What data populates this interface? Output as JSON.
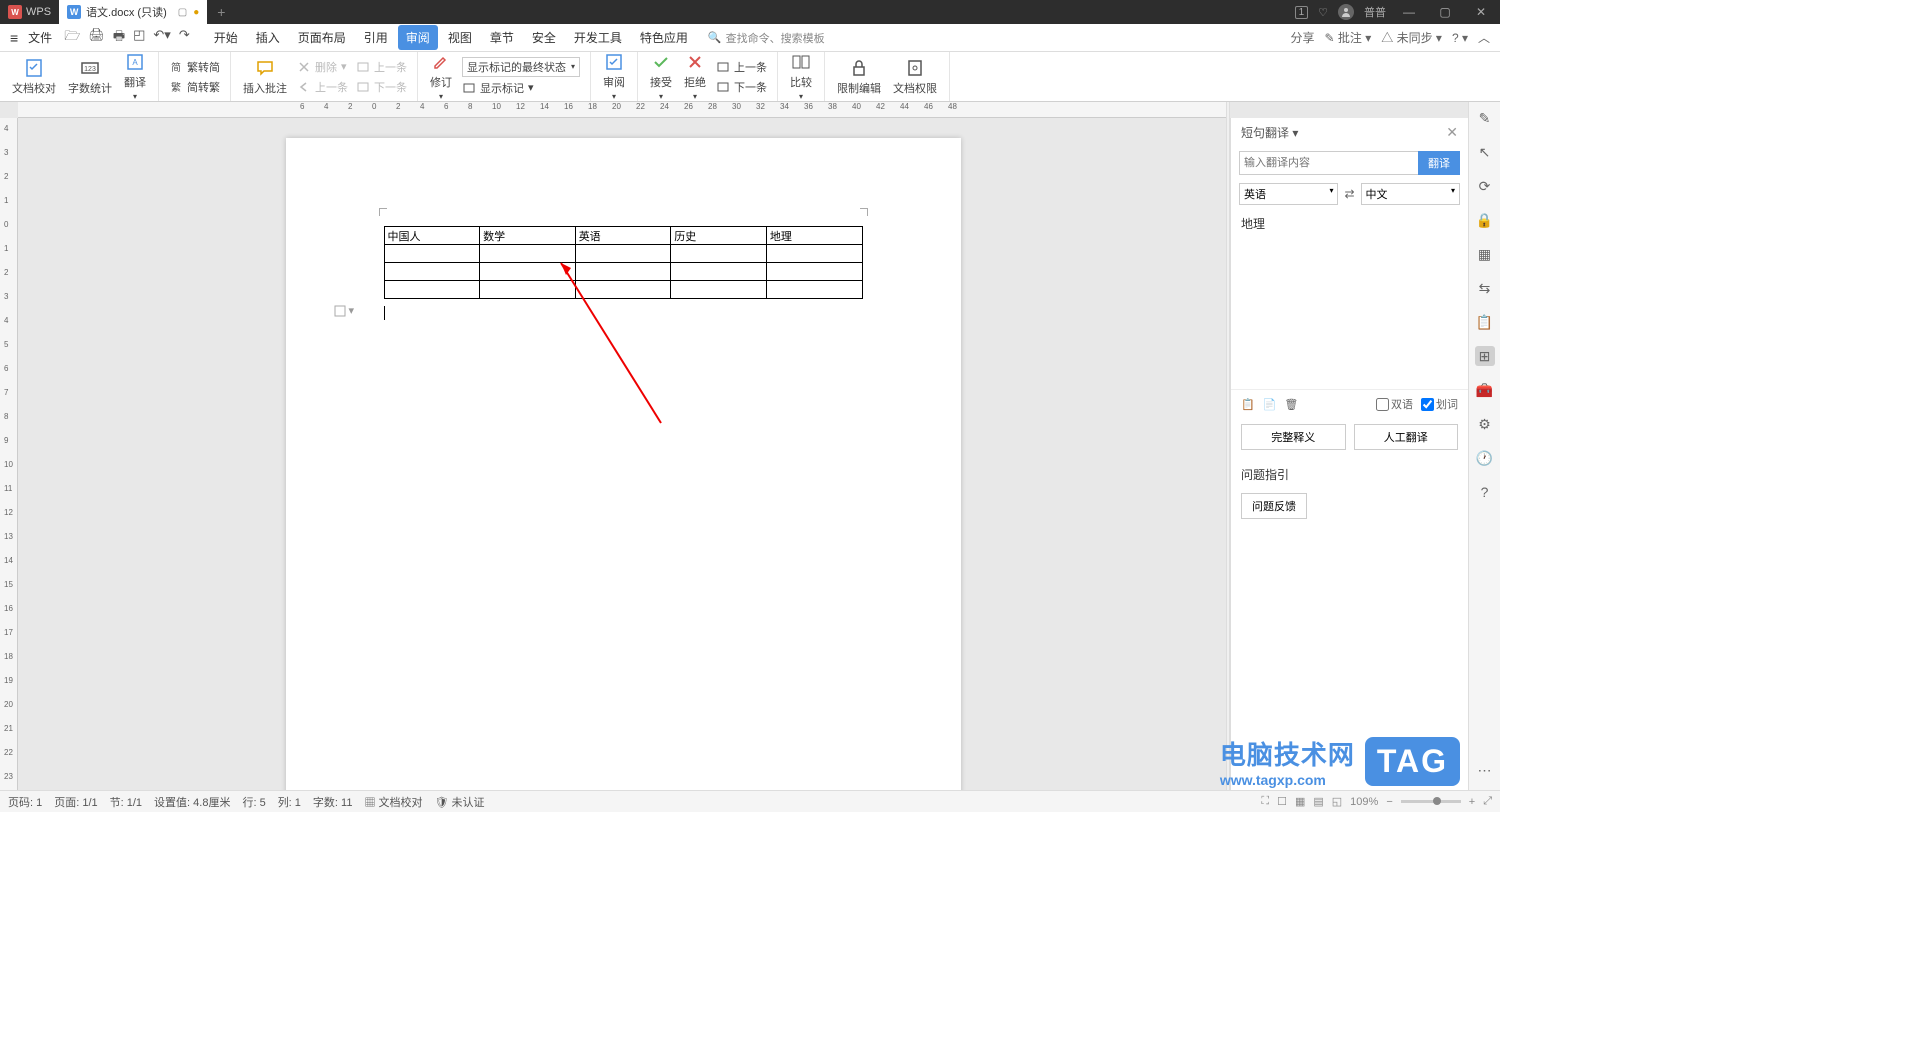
{
  "titlebar": {
    "app_name": "WPS",
    "doc_tab": "语文.docx (只读)",
    "user_name": "普普"
  },
  "menubar": {
    "file": "文件",
    "tabs": [
      "开始",
      "插入",
      "页面布局",
      "引用",
      "审阅",
      "视图",
      "章节",
      "安全",
      "开发工具",
      "特色应用"
    ],
    "active_tab": "审阅",
    "search_placeholder": "查找命令、搜索模板",
    "share": "分享",
    "comment": "批注",
    "sync": "未同步"
  },
  "ribbon": {
    "doc_check": "文档校对",
    "word_count": "字数统计",
    "translate": "翻译",
    "trad_to_simp": "繁转简",
    "simp_to_trad": "简转繁",
    "insert_comment": "插入批注",
    "delete": "删除",
    "prev_cmt": "上一条",
    "next_cmt": "下一条",
    "revise": "修订",
    "markup_state": "显示标记的最终状态",
    "show_markup": "显示标记",
    "review": "审阅",
    "accept": "接受",
    "reject": "拒绝",
    "prev": "上一条",
    "next": "下一条",
    "compare": "比较",
    "restrict": "限制编辑",
    "doc_auth": "文档权限"
  },
  "document": {
    "table": {
      "headers": [
        "中国人",
        "数学",
        "英语",
        "历史",
        "地理"
      ]
    }
  },
  "translation_pane": {
    "title": "短句翻译",
    "input_placeholder": "输入翻译内容",
    "translate_btn": "翻译",
    "src_lang": "英语",
    "tgt_lang": "中文",
    "result": "地理",
    "bilingual": "双语",
    "segment": "划词",
    "full_def": "完整释义",
    "human_trans": "人工翻译",
    "issue_guide": "问题指引",
    "feedback": "问题反馈"
  },
  "statusbar": {
    "page_num": "页码: 1",
    "page": "页面: 1/1",
    "section": "节: 1/1",
    "pos": "设置值: 4.8厘米",
    "line": "行: 5",
    "col": "列: 1",
    "chars": "字数: 11",
    "doc_check": "文档校对",
    "cert": "未认证",
    "zoom": "109%"
  },
  "watermark": {
    "line1": "电脑技术网",
    "line2": "www.tagxp.com",
    "tag": "TAG"
  }
}
